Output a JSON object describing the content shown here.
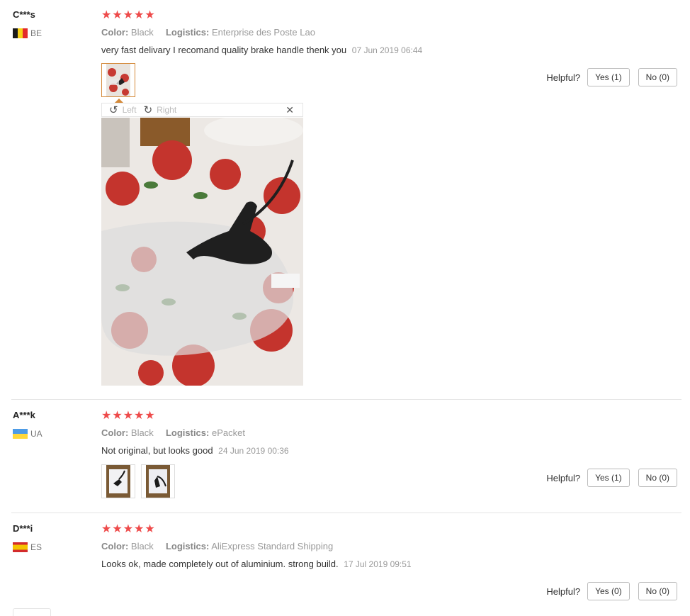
{
  "labels": {
    "color": "Color:",
    "logistics": "Logistics:",
    "helpful": "Helpful?",
    "viewer_left": "Left",
    "viewer_right": "Right"
  },
  "colors": {
    "star": "#ee4a4a",
    "thumb_active_border": "#d48a3a"
  },
  "reviews": [
    {
      "user": "C***s",
      "country": "BE",
      "rating": 5,
      "stars": "★★★★★",
      "color": "Black",
      "logistics": "Enterprise des Poste Lao",
      "comment": "very fast delivary I recomand quality brake handle thenk you",
      "date": "07 Jun 2019 06:44",
      "yes": "Yes (1)",
      "no": "No (0)"
    },
    {
      "user": "A***k",
      "country": "UA",
      "rating": 5,
      "stars": "★★★★★",
      "color": "Black",
      "logistics": "ePacket",
      "comment": "Not original, but looks good",
      "date": "24 Jun 2019 00:36",
      "yes": "Yes (1)",
      "no": "No (0)"
    },
    {
      "user": "D***i",
      "country": "ES",
      "rating": 5,
      "stars": "★★★★★",
      "color": "Black",
      "logistics": "AliExpress Standard Shipping",
      "comment": "Looks ok, made completely out of aluminium. strong build.",
      "date": "17 Jul 2019 09:51",
      "yes": "Yes (0)",
      "no": "No (0)"
    }
  ],
  "icons": {
    "rotate_left": "rotate-left-icon",
    "rotate_right": "rotate-right-icon",
    "close": "close-icon"
  }
}
